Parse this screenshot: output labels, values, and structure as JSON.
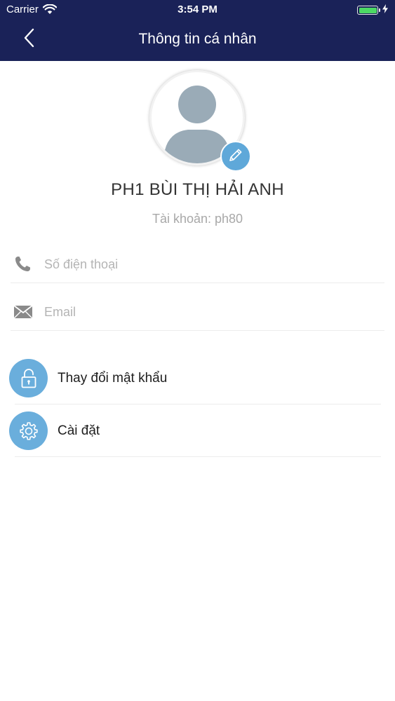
{
  "status_bar": {
    "carrier": "Carrier",
    "time": "3:54 PM",
    "battery_level": 1.0
  },
  "header": {
    "title": "Thông tin cá nhân",
    "back_icon": "chevron-left-icon",
    "background_color": "#1a2258"
  },
  "profile": {
    "name": "PH1 BÙI THỊ HẢI ANH",
    "account_line": "Tài khoản: ph80",
    "avatar_icon": "user-placeholder-icon",
    "edit_icon": "pencil-icon"
  },
  "fields": [
    {
      "icon": "phone-icon",
      "placeholder": "Số điện thoại",
      "value": ""
    },
    {
      "icon": "mail-icon",
      "placeholder": "Email",
      "value": ""
    }
  ],
  "menu": [
    {
      "icon": "lock-open-icon",
      "label": "Thay đổi mật khẩu"
    },
    {
      "icon": "gear-icon",
      "label": "Cài đặt"
    }
  ],
  "colors": {
    "accent": "#6aaedc",
    "battery": "#4cd964"
  }
}
